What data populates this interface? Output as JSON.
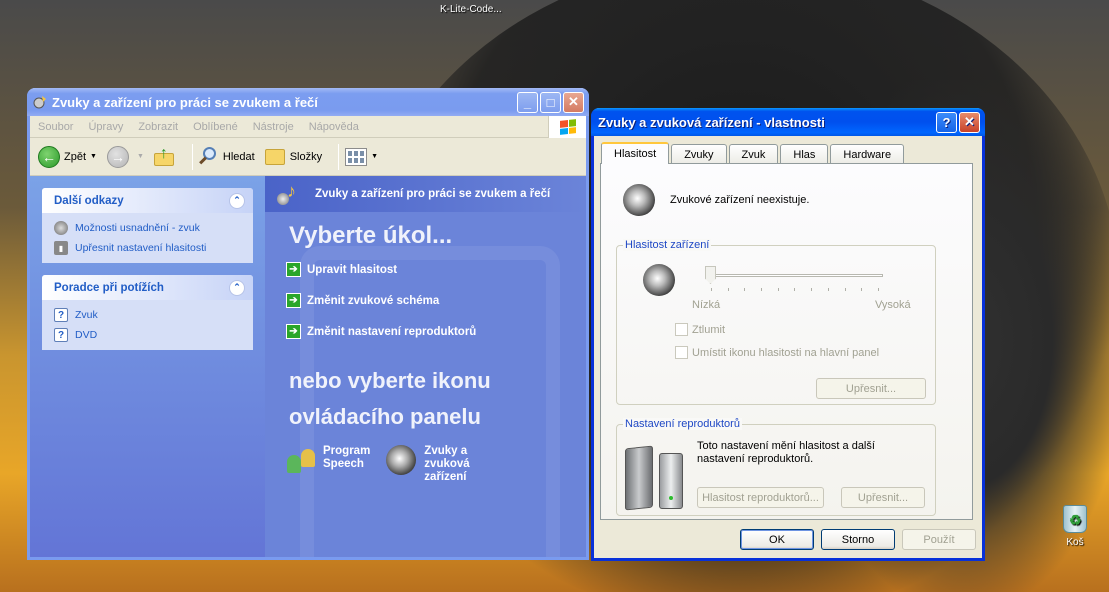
{
  "desktop": {
    "top_label": "K-Lite-Code...",
    "recycle_bin": "Koš"
  },
  "control_panel": {
    "title": "Zvuky a zařízení pro práci se zvukem a řečí",
    "menu": [
      "Soubor",
      "Úpravy",
      "Zobrazit",
      "Oblíbené",
      "Nástroje",
      "Nápověda"
    ],
    "toolbar": {
      "back": "Zpět",
      "search": "Hledat",
      "folders": "Složky"
    },
    "panels": [
      {
        "title": "Další odkazy",
        "links": [
          "Možnosti usnadnění - zvuk",
          "Upřesnit nastavení hlasitosti"
        ]
      },
      {
        "title": "Poradce při potížích",
        "links": [
          "Zvuk",
          "DVD"
        ]
      }
    ],
    "category_header": "Zvuky a zařízení pro práci se zvukem a řečí",
    "pick_task": "Vyberte úkol...",
    "tasks": [
      "Upravit hlasitost",
      "Změnit zvukové schéma",
      "Změnit nastavení reproduktorů"
    ],
    "or_pick_line1": "nebo vyberte ikonu",
    "or_pick_line2": "ovládacího panelu",
    "icons": [
      {
        "line1": "Program",
        "line2": "Speech",
        "line3": ""
      },
      {
        "line1": "Zvuky a",
        "line2": "zvuková",
        "line3": "zařízení"
      }
    ]
  },
  "properties": {
    "title": "Zvuky a zvuková zařízení - vlastnosti",
    "tabs": [
      "Hlasitost",
      "Zvuky",
      "Zvuk",
      "Hlas",
      "Hardware"
    ],
    "active_tab": "Hlasitost",
    "no_device": "Zvukové zařízení neexistuje.",
    "volume_group": "Hlasitost zařízení",
    "low": "Nízká",
    "high": "Vysoká",
    "volume_level": 0,
    "mute": "Ztlumit",
    "tray_icon": "Umístit ikonu hlasitosti na hlavní panel",
    "advanced": "Upřesnit...",
    "speaker_group": "Nastavení reproduktorů",
    "speaker_text_1": "Toto nastavení mění hlasitost a další",
    "speaker_text_2": "nastavení reproduktorů.",
    "speaker_volume": "Hlasitost reproduktorů...",
    "speaker_advanced": "Upřesnit...",
    "ok": "OK",
    "cancel": "Storno",
    "apply": "Použít"
  },
  "colors": {
    "xp_title_blue": "#0053ee",
    "cp_left_panel": "#6375d6",
    "link_blue": "#215dc6"
  }
}
